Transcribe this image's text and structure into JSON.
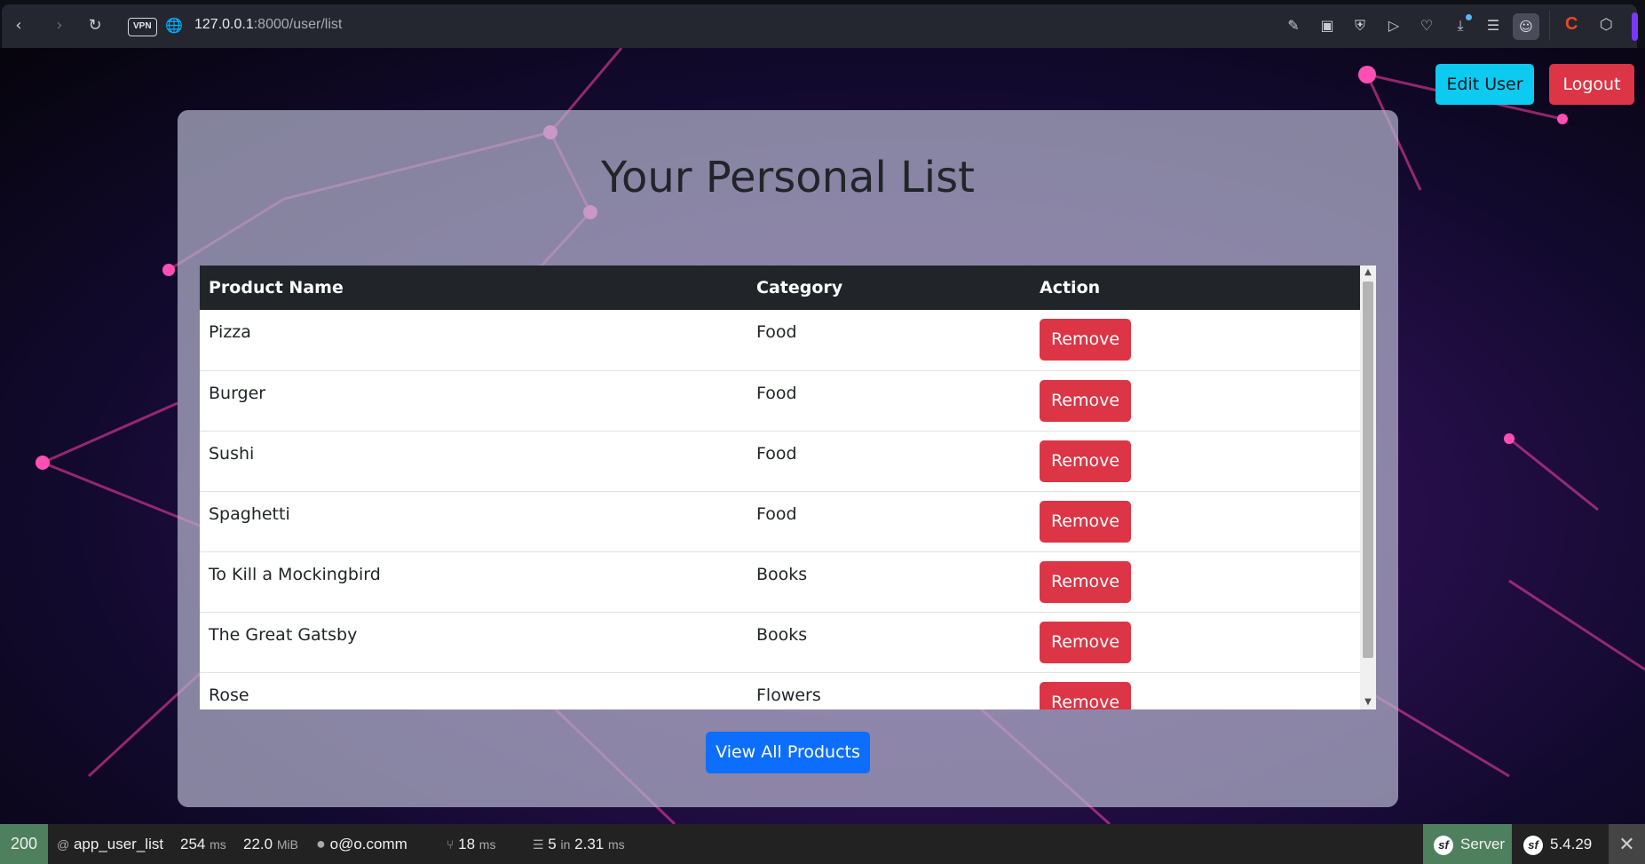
{
  "browser": {
    "vpn_label": "VPN",
    "url_host": "127.0.0.1",
    "url_rest": ":8000/user/list"
  },
  "header": {
    "edit_user_label": "Edit User",
    "logout_label": "Logout"
  },
  "main": {
    "title": "Your Personal List",
    "table": {
      "columns": [
        "Product Name",
        "Category",
        "Action"
      ],
      "remove_label": "Remove",
      "rows": [
        {
          "name": "Pizza",
          "category": "Food"
        },
        {
          "name": "Burger",
          "category": "Food"
        },
        {
          "name": "Sushi",
          "category": "Food"
        },
        {
          "name": "Spaghetti",
          "category": "Food"
        },
        {
          "name": "To Kill a Mockingbird",
          "category": "Books"
        },
        {
          "name": "The Great Gatsby",
          "category": "Books"
        },
        {
          "name": "Rose",
          "category": "Flowers"
        }
      ]
    },
    "view_all_label": "View All Products"
  },
  "debug_toolbar": {
    "status": "200",
    "route_prefix": "@",
    "route": "app_user_list",
    "time_value": "254",
    "time_unit": "ms",
    "memory_value": "22.0",
    "memory_unit": "MiB",
    "user": "o@o.comm",
    "twig_value": "18",
    "twig_unit": "ms",
    "db_count": "5",
    "db_in": "in",
    "db_time": "2.31",
    "db_unit": "ms",
    "server_label": "Server",
    "version": "5.4.29"
  },
  "colors": {
    "accent_info": "#0dcaf0",
    "danger": "#dc3545",
    "primary": "#0d6efd",
    "status_ok": "#4f805d"
  }
}
